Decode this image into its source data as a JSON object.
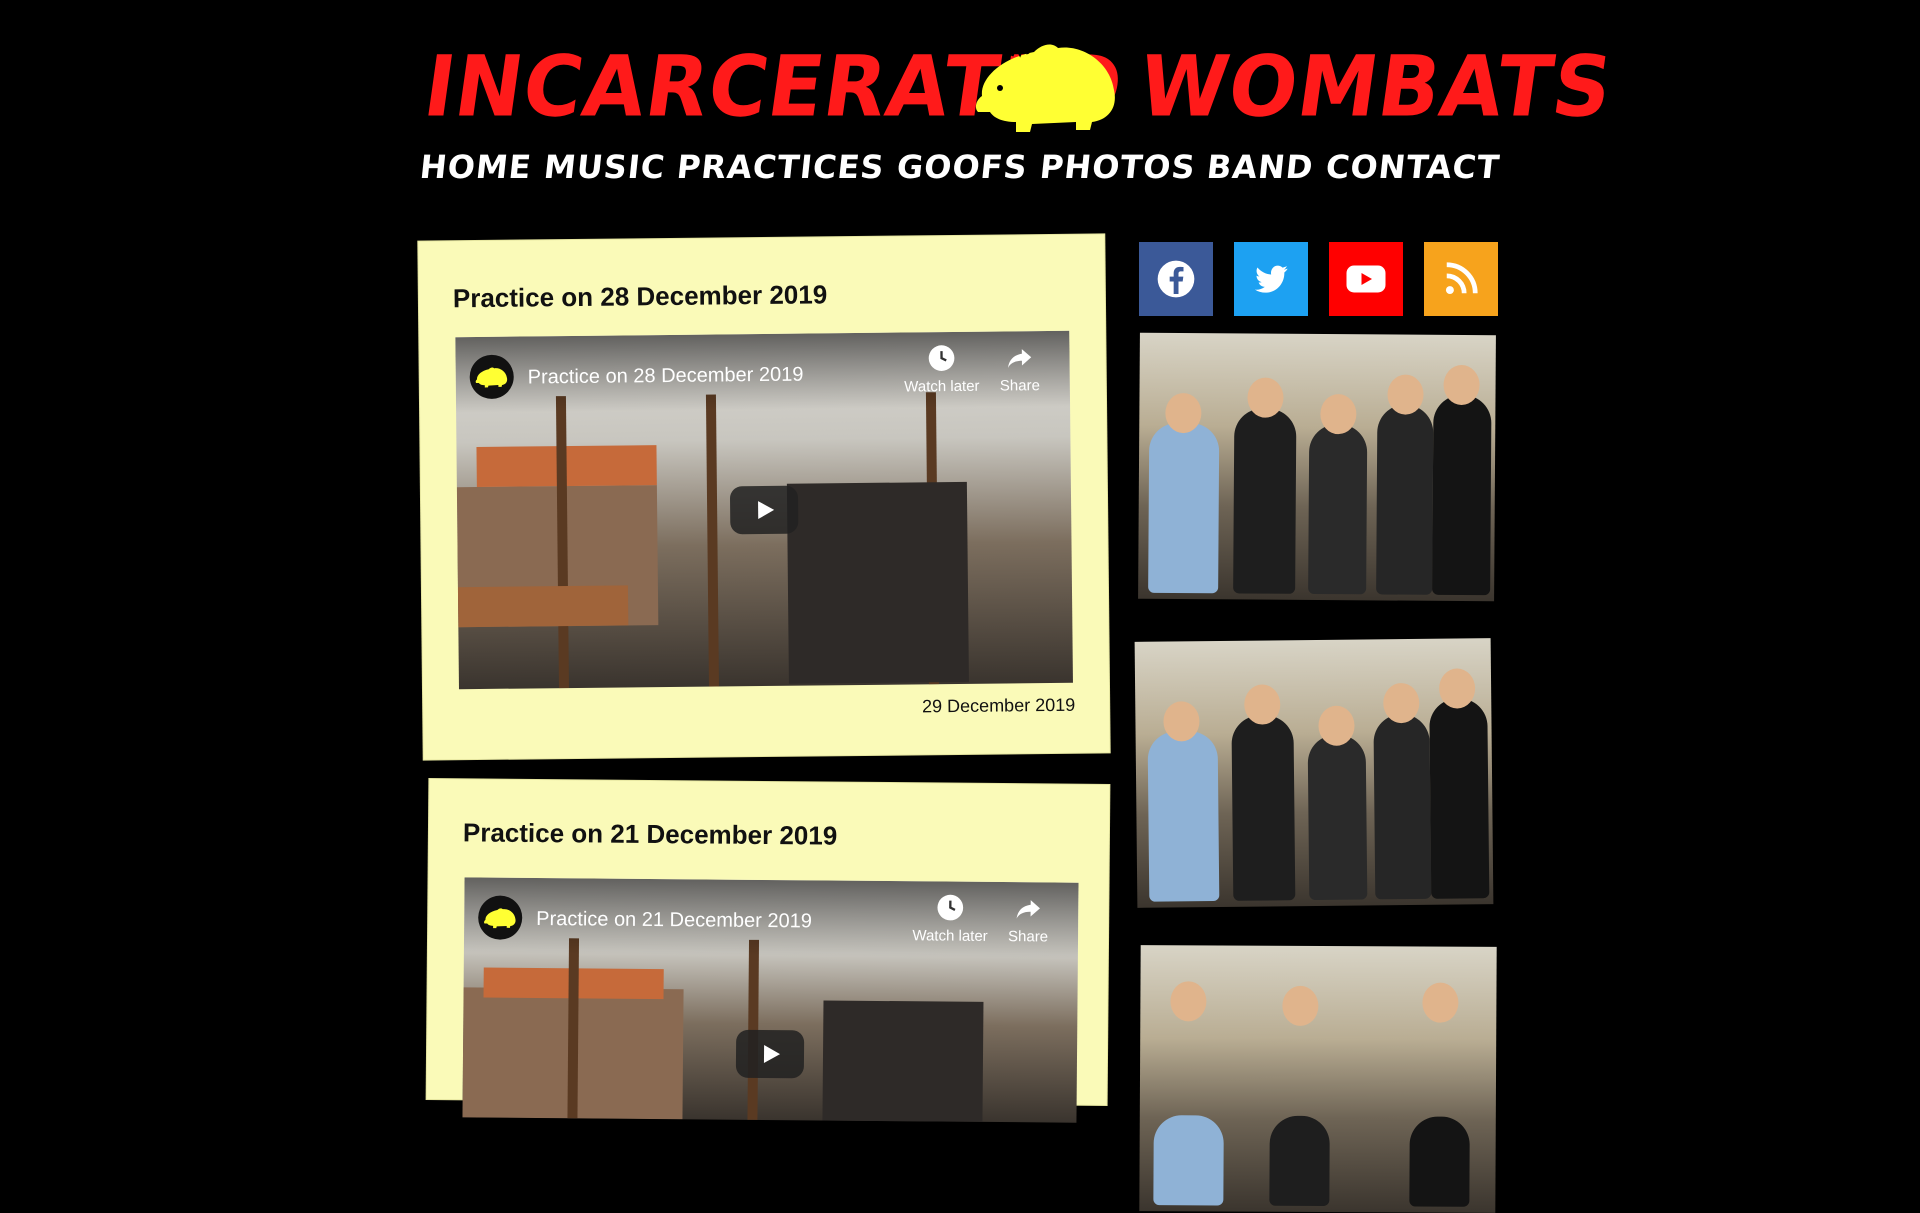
{
  "site": {
    "name_left": "INCARCERATED",
    "name_right": "WOMBATS",
    "logo_icon": "wombat-icon",
    "accent_red": "#ff1a1a",
    "logo_yellow": "#ffff33"
  },
  "nav": [
    "HOME",
    "MUSIC",
    "PRACTICES",
    "GOOFS",
    "PHOTOS",
    "BAND",
    "CONTACT"
  ],
  "posts": [
    {
      "title": "Practice on 28 December 2019",
      "video_title": "Practice on 28 December 2019",
      "watch_later": "Watch later",
      "share": "Share",
      "date": "29 December 2019"
    },
    {
      "title": "Practice on 21 December 2019",
      "video_title": "Practice on 21 December 2019",
      "watch_later": "Watch later",
      "share": "Share"
    }
  ],
  "social": [
    {
      "name": "facebook",
      "icon": "facebook-icon",
      "color": "#3b5998"
    },
    {
      "name": "twitter",
      "icon": "twitter-icon",
      "color": "#1da1f2"
    },
    {
      "name": "youtube",
      "icon": "youtube-icon",
      "color": "#ff0000"
    },
    {
      "name": "rss",
      "icon": "rss-icon",
      "color": "#f7a31c"
    }
  ],
  "card_color": "#fafab8"
}
